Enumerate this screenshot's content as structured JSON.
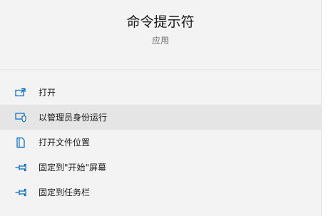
{
  "header": {
    "title": "命令提示符",
    "subtitle": "应用"
  },
  "menu": {
    "accent_color": "#0067c0",
    "items": [
      {
        "label": "打开",
        "icon": "open-icon",
        "selected": false
      },
      {
        "label": "以管理员身份运行",
        "icon": "shield-icon",
        "selected": true
      },
      {
        "label": "打开文件位置",
        "icon": "file-location-icon",
        "selected": false
      },
      {
        "label": "固定到\"开始\"屏幕",
        "icon": "pin-icon",
        "selected": false
      },
      {
        "label": "固定到任务栏",
        "icon": "pin-icon",
        "selected": false
      }
    ]
  }
}
